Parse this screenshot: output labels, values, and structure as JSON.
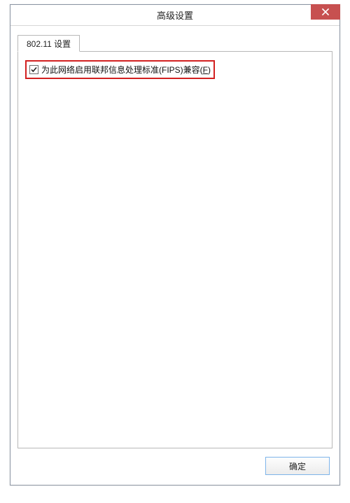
{
  "window": {
    "title": "高级设置"
  },
  "tabs": [
    {
      "label": "802.11 设置"
    }
  ],
  "fips_checkbox": {
    "checked": true,
    "label_pre": "为此网络启用联邦信息处理标准(FIPS)兼容(",
    "mnemonic": "F",
    "label_post": ")"
  },
  "buttons": {
    "ok": "确定"
  },
  "colors": {
    "highlight": "#d22020",
    "close_bg": "#c75050"
  }
}
